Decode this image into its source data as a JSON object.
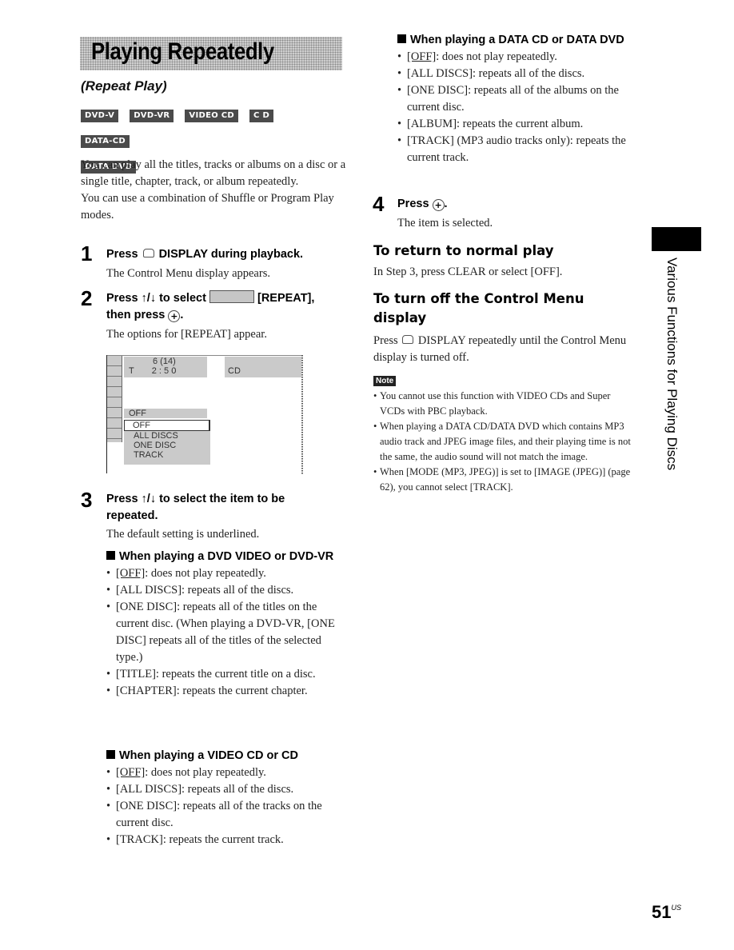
{
  "page": {
    "title": "Playing Repeatedly",
    "subtitle": "(Repeat Play)",
    "disc_badges": [
      "DVD-V",
      "DVD-VR",
      "VIDEO CD",
      "C D",
      "DATA-CD",
      "DATA DVD"
    ],
    "intro": [
      "You can play all the titles, tracks or albums on a disc or a single title, chapter, track, or album repeatedly.",
      "You can use a combination of Shuffle or Program Play modes."
    ],
    "steps": [
      {
        "num": "1",
        "head_pre": "Press",
        "head_post": "DISPLAY during playback.",
        "body": "The Control Menu display appears."
      },
      {
        "num": "2",
        "head_pre": "Press ↑/↓ to select",
        "head_mid": "[REPEAT],",
        "head_line2": "then press",
        "body": "The options for [REPEAT] appear."
      },
      {
        "num": "3",
        "head": "Press ↑/↓ to select the item to be repeated.",
        "body": "The default setting is underlined."
      },
      {
        "num": "4",
        "head_pre": "Press",
        "body": "The item is selected."
      }
    ],
    "osd": {
      "track_line1": "6 (14)",
      "track_line2_left": "T",
      "track_line2_right": "2 : 5 0",
      "disc_type": "CD",
      "current_setting": "OFF",
      "options": [
        "OFF",
        "ALL DISCS",
        "ONE DISC",
        "TRACK"
      ],
      "selected_option": "OFF"
    },
    "sections": {
      "dvd": {
        "heading": "When playing a DVD VIDEO or DVD-VR",
        "items": [
          {
            "key": "[OFF]",
            "text": ": does not play repeatedly.",
            "default": true
          },
          {
            "key": "[ALL DISCS]",
            "text": ": repeats all of the discs."
          },
          {
            "key": "[ONE DISC]",
            "text": ": repeats all of the titles on the current disc. (When playing a DVD-VR, [ONE DISC] repeats all of the titles of the selected type.)"
          },
          {
            "key": "[TITLE]",
            "text": ": repeats the current title on a disc."
          },
          {
            "key": "[CHAPTER]",
            "text": ": repeats the current chapter."
          }
        ]
      },
      "vcd": {
        "heading": "When playing a VIDEO CD or CD",
        "items": [
          {
            "key": "[OFF]",
            "text": ": does not play repeatedly.",
            "default": true
          },
          {
            "key": "[ALL DISCS]",
            "text": ": repeats all of the discs."
          },
          {
            "key": "[ONE DISC]",
            "text": ": repeats all of the tracks on the current disc."
          },
          {
            "key": "[TRACK]",
            "text": ": repeats the current track."
          }
        ]
      },
      "data": {
        "heading": "When playing a DATA CD or DATA DVD",
        "items": [
          {
            "key": "[OFF]",
            "text": ": does not play repeatedly.",
            "default": true
          },
          {
            "key": "[ALL DISCS]",
            "text": ": repeats all of the discs."
          },
          {
            "key": "[ONE DISC]",
            "text": ": repeats all of the albums on the current disc."
          },
          {
            "key": "[ALBUM]",
            "text": ": repeats the current album."
          },
          {
            "key": "[TRACK]",
            "text": " (MP3 audio tracks only): repeats the current track."
          }
        ]
      }
    },
    "return_normal": {
      "heading": "To return to normal play",
      "body": "In Step 3, press CLEAR or select [OFF]."
    },
    "turn_off": {
      "heading": "To turn off the Control Menu display",
      "body_pre": "Press",
      "body_post": "DISPLAY repeatedly until the Control Menu display is turned off."
    },
    "note": {
      "label": "Note",
      "items": [
        "You cannot use this function with VIDEO CDs and Super VCDs with PBC playback.",
        "When playing a DATA CD/DATA DVD which contains MP3 audio track and JPEG image files, and their playing time is not the same, the audio sound will not match the image.",
        "When [MODE (MP3, JPEG)] is set to [IMAGE (JPEG)] (page 62), you cannot select [TRACK]."
      ]
    },
    "side_tab": "Various Functions for Playing Discs",
    "page_number": "51",
    "page_suffix": "US"
  }
}
